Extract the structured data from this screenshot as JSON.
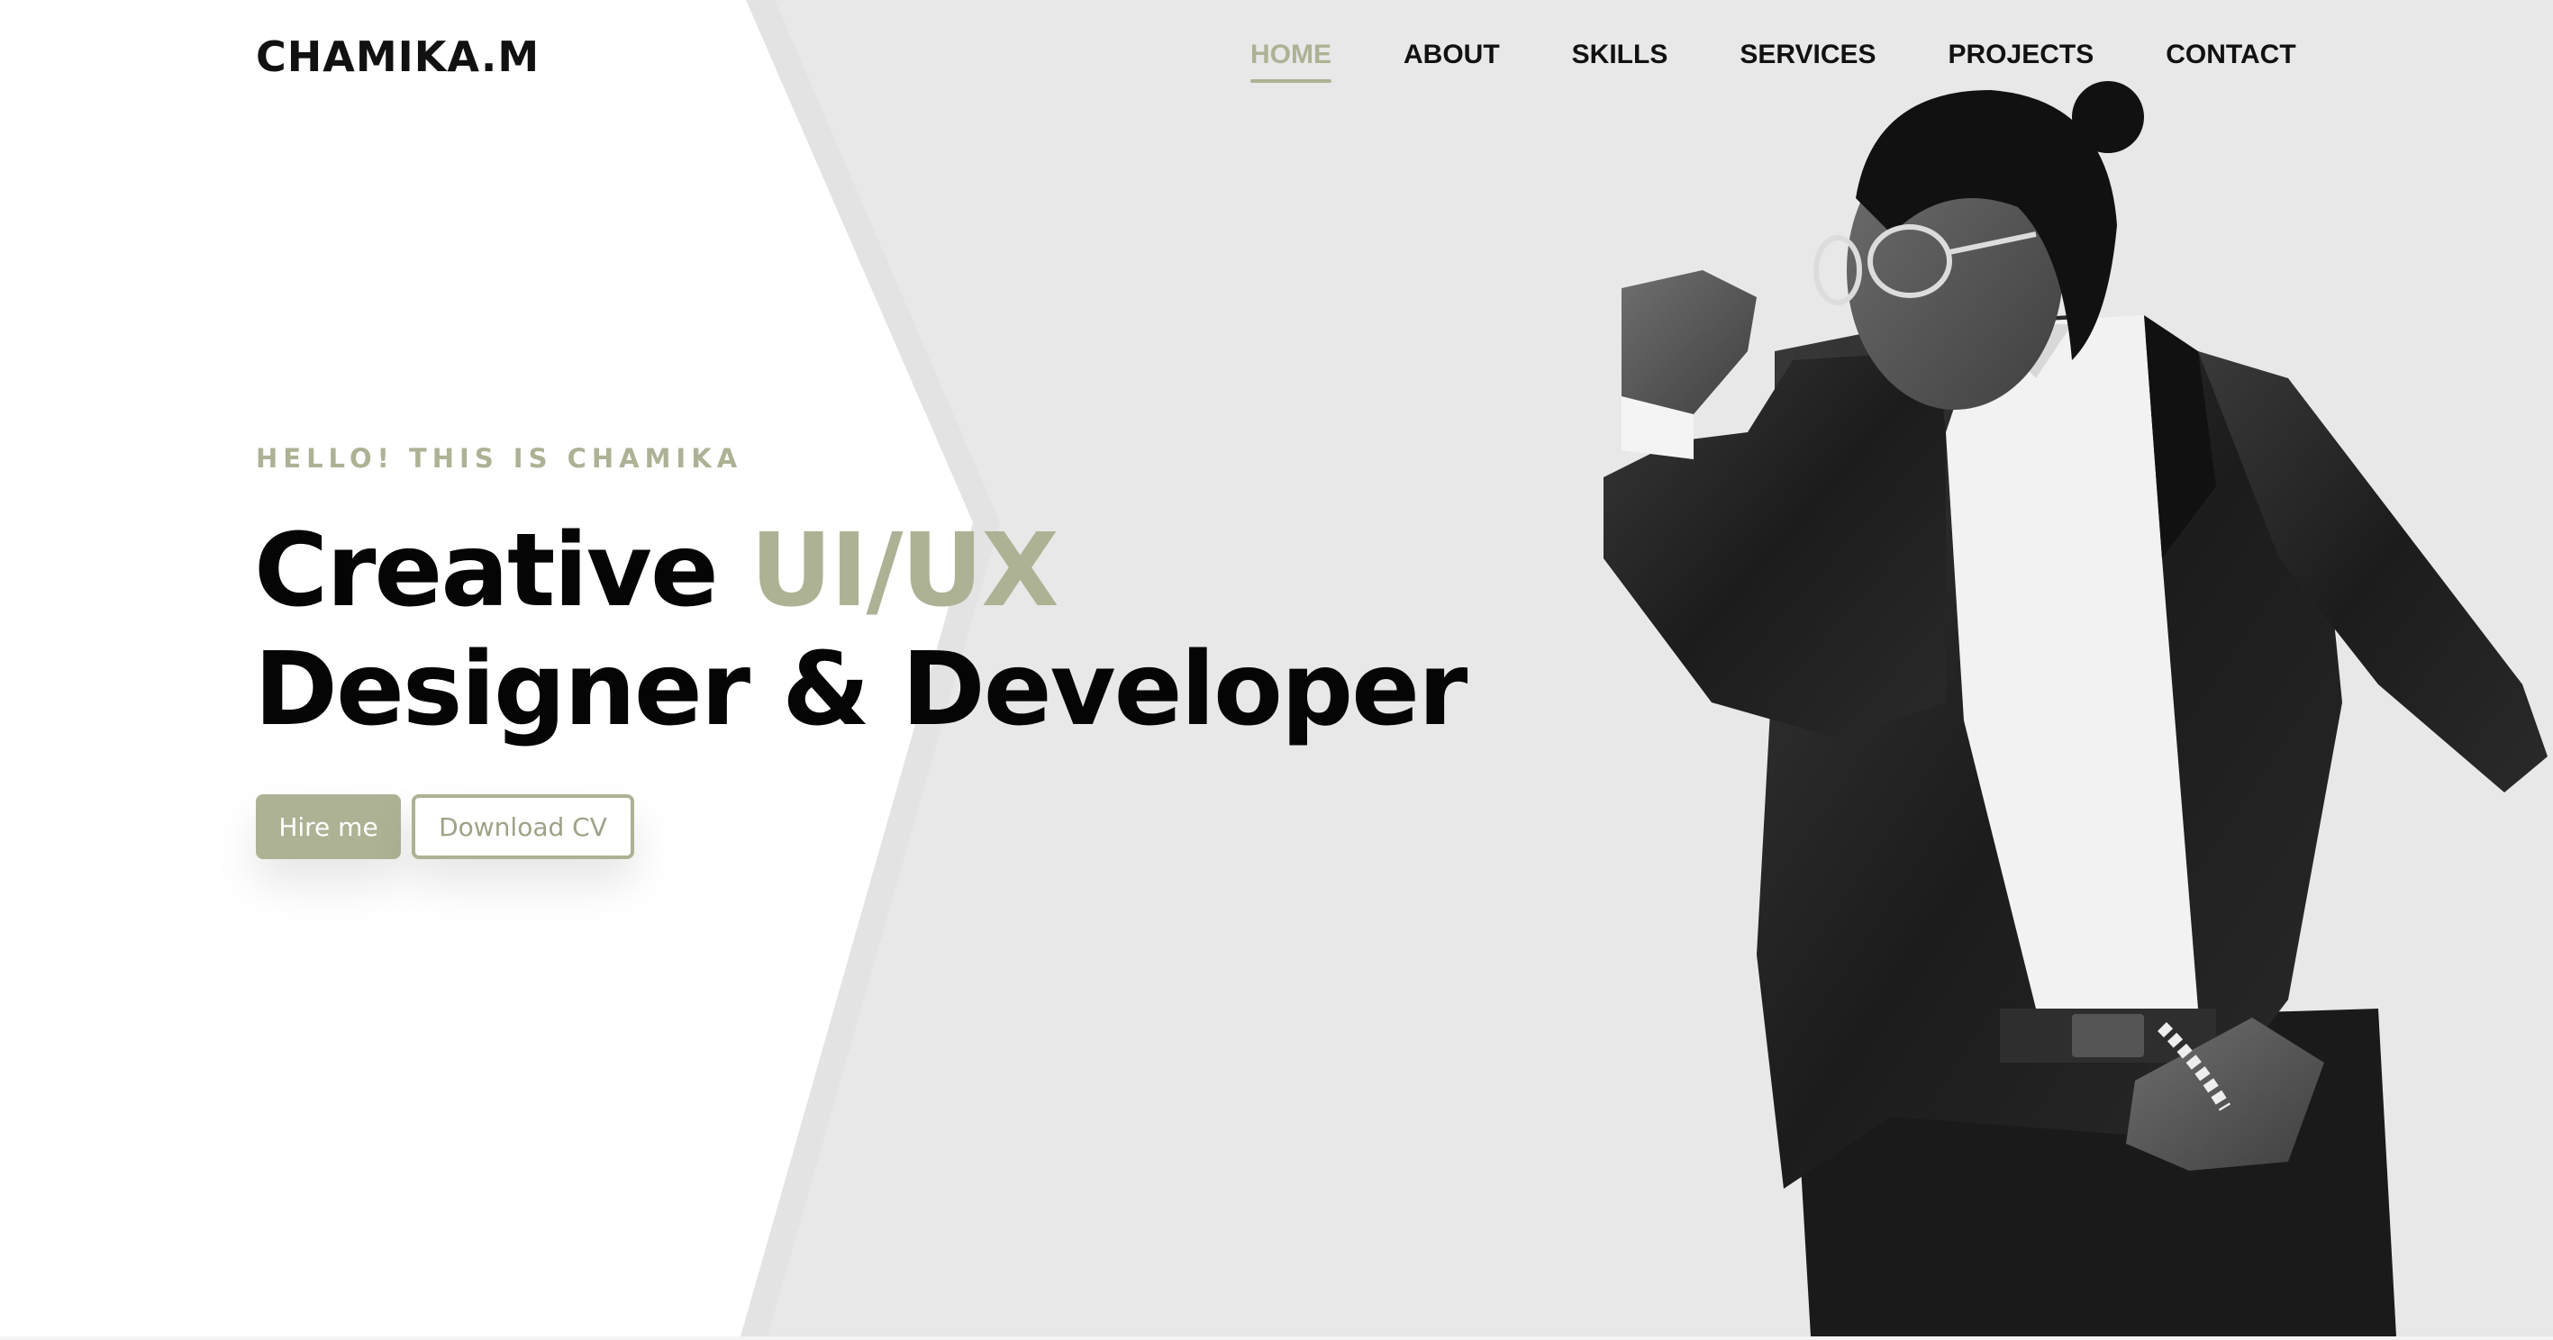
{
  "header": {
    "logo": "CHAMIKA.M",
    "nav": [
      {
        "label": "HOME",
        "active": true
      },
      {
        "label": "ABOUT",
        "active": false
      },
      {
        "label": "SKILLS",
        "active": false
      },
      {
        "label": "SERVICES",
        "active": false
      },
      {
        "label": "PROJECTS",
        "active": false
      },
      {
        "label": "CONTACT",
        "active": false
      }
    ]
  },
  "hero": {
    "eyebrow": "HELLO! THIS IS CHAMIKA",
    "headline_line1_main": "Creative ",
    "headline_line1_accent": "UI/UX",
    "headline_line2": "Designer & Developer",
    "primary_button": "Hire me",
    "secondary_button": "Download CV",
    "portrait": "portrait-photo"
  },
  "colors": {
    "accent": "#aeb295",
    "text": "#050505",
    "background_left": "#ffffff",
    "background_right": "#e8e8e8"
  }
}
